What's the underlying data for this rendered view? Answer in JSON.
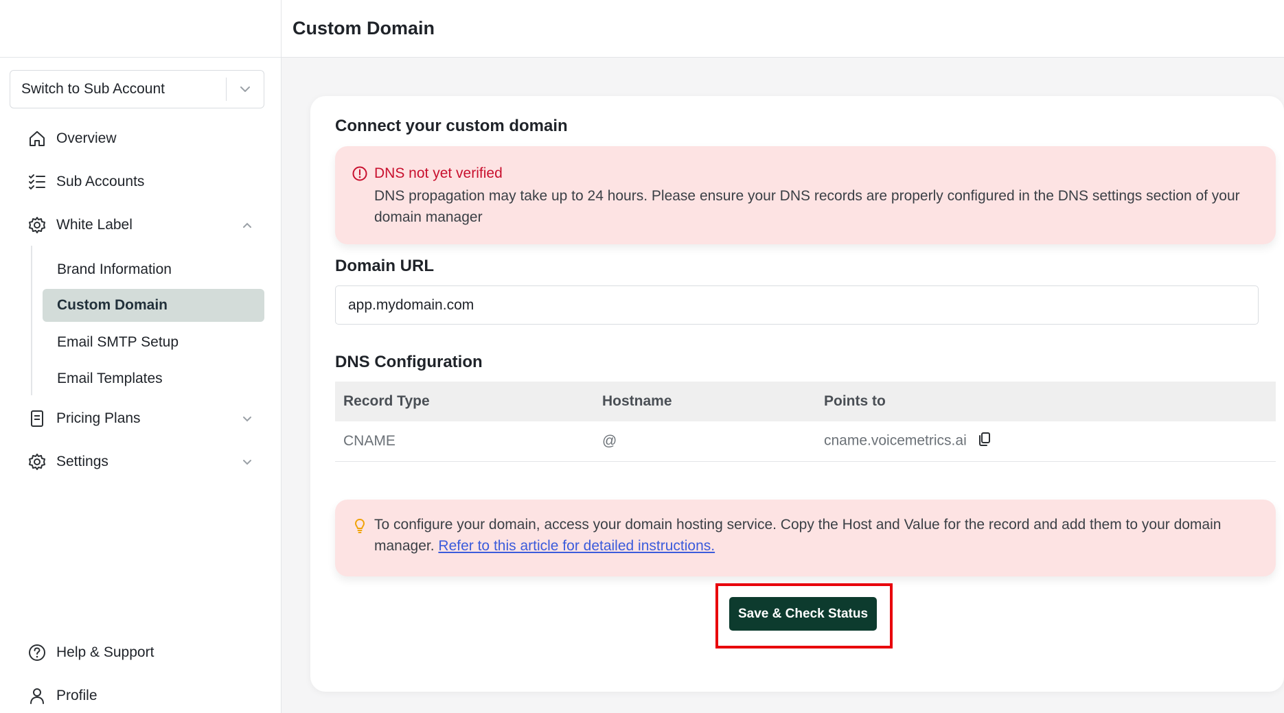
{
  "header": {
    "title": "Custom Domain"
  },
  "sidebar": {
    "switcher": {
      "label": "Switch to Sub Account"
    },
    "items": [
      {
        "label": "Overview",
        "icon": "home-icon"
      },
      {
        "label": "Sub Accounts",
        "icon": "list-check-icon"
      },
      {
        "label": "White Label",
        "icon": "gear-icon",
        "expanded": true
      },
      {
        "label": "Pricing Plans",
        "icon": "document-icon"
      },
      {
        "label": "Settings",
        "icon": "gear-icon"
      }
    ],
    "white_label_sub": [
      {
        "label": "Brand Information",
        "active": false
      },
      {
        "label": "Custom Domain",
        "active": true
      },
      {
        "label": "Email SMTP Setup",
        "active": false
      },
      {
        "label": "Email Templates",
        "active": false
      }
    ],
    "footer": [
      {
        "label": "Help & Support",
        "icon": "question-icon"
      },
      {
        "label": "Profile",
        "icon": "user-icon"
      }
    ]
  },
  "main": {
    "card_title": "Connect your custom domain",
    "dns_alert": {
      "title": "DNS not yet verified",
      "body": "DNS propagation may take up to 24 hours. Please ensure your DNS records are properly configured in the DNS settings section of your domain manager"
    },
    "domain_url": {
      "label": "Domain URL",
      "value": "app.mydomain.com"
    },
    "dns_config": {
      "title": "DNS Configuration",
      "columns": [
        "Record Type",
        "Hostname",
        "Points to"
      ],
      "rows": [
        {
          "record_type": "CNAME",
          "hostname": "@",
          "points_to": "cname.voicemetrics.ai"
        }
      ]
    },
    "tip": {
      "text": "To configure your domain, access your domain hosting service. Copy the Host and Value for the record and add them to your domain manager.",
      "link": "Refer to this article for detailed instructions."
    },
    "save_button": "Save & Check Status"
  },
  "colors": {
    "accent": "#0d3b2e",
    "error": "#c8102e",
    "alert_bg": "#fde3e3",
    "active_nav": "#d3dcd9",
    "highlight": "#e8000b",
    "tip_icon": "#f0a30a"
  }
}
